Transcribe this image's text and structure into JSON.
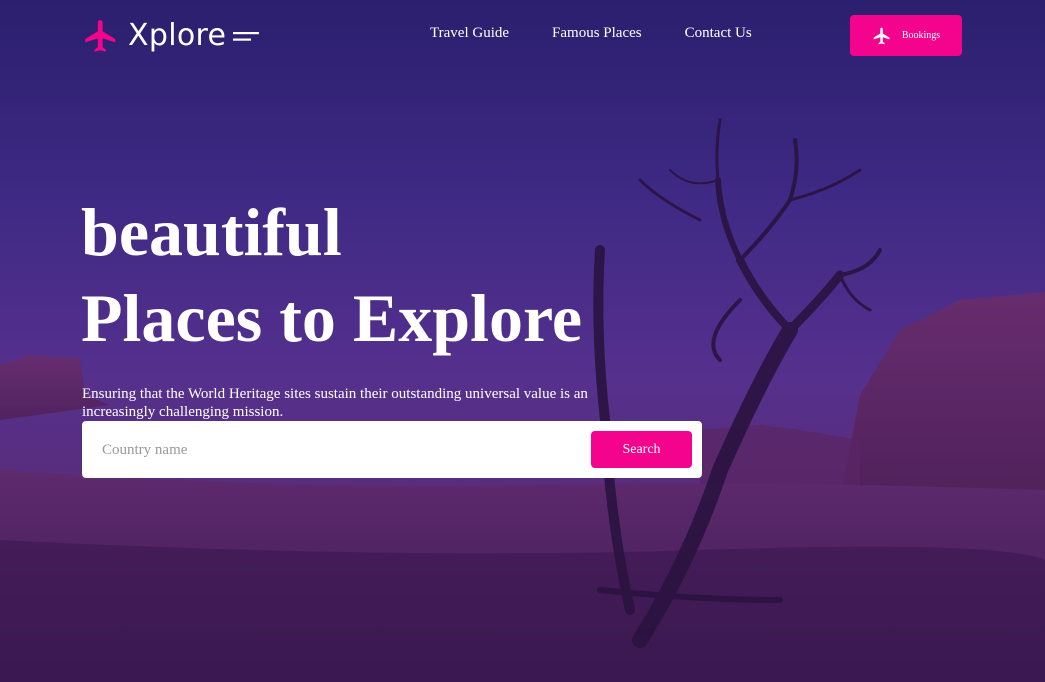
{
  "brand": {
    "name": "Xplore",
    "color": "#f4048c",
    "icon": "airplane-icon"
  },
  "nav": {
    "links": [
      {
        "label": "Travel Guide"
      },
      {
        "label": "Famous Places"
      },
      {
        "label": "Contact Us"
      }
    ],
    "bookings_label": "Bookings"
  },
  "hero": {
    "title_line1": "beautiful",
    "title_line2": "Places to Explore",
    "subtitle": "Ensuring that the World Heritage sites sustain their outstanding universal value is an increasingly challenging mission."
  },
  "search": {
    "placeholder": "Country name",
    "value": "",
    "button_label": "Search"
  },
  "colors": {
    "accent": "#f4048c",
    "overlay": "#3d2a80"
  }
}
